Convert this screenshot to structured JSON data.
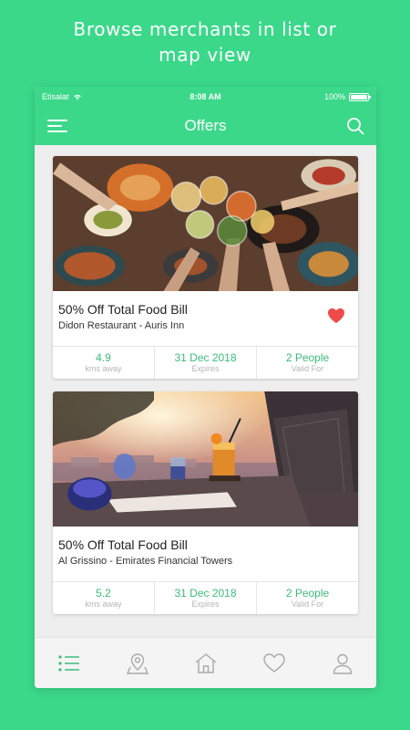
{
  "promo": {
    "line1": "Browse merchants in list or",
    "line2": "map view"
  },
  "status": {
    "carrier": "Etisalat",
    "time": "8:08 AM",
    "battery": "100%",
    "battery_level": 1.0
  },
  "appbar": {
    "title": "Offers"
  },
  "offers": [
    {
      "title": "50% Off Total Food Bill",
      "merchant": "Didon Restaurant - Auris Inn",
      "favorited": true,
      "distance_value": "4.9",
      "distance_label": "kms away",
      "expiry_value": "31 Dec 2018",
      "expiry_label": "Expires",
      "people_value": "2 People",
      "people_label": "Valid For"
    },
    {
      "title": "50% Off Total Food Bill",
      "merchant": "Al Grissino - Emirates Financial Towers",
      "favorited": false,
      "distance_value": "5.2",
      "distance_label": "kms away",
      "expiry_value": "31 Dec 2018",
      "expiry_label": "Expires",
      "people_value": "2 People",
      "people_label": "Valid For"
    }
  ],
  "tabs": [
    {
      "icon": "list-icon",
      "active": true
    },
    {
      "icon": "map-pin-icon",
      "active": false
    },
    {
      "icon": "home-icon",
      "active": false
    },
    {
      "icon": "heart-icon",
      "active": false
    },
    {
      "icon": "user-icon",
      "active": false
    }
  ],
  "colors": {
    "brand": "#3bd88a",
    "accent_text": "#3dbb7a",
    "favorite": "#ef4b4b",
    "tab_inactive": "#a9a9a9"
  }
}
